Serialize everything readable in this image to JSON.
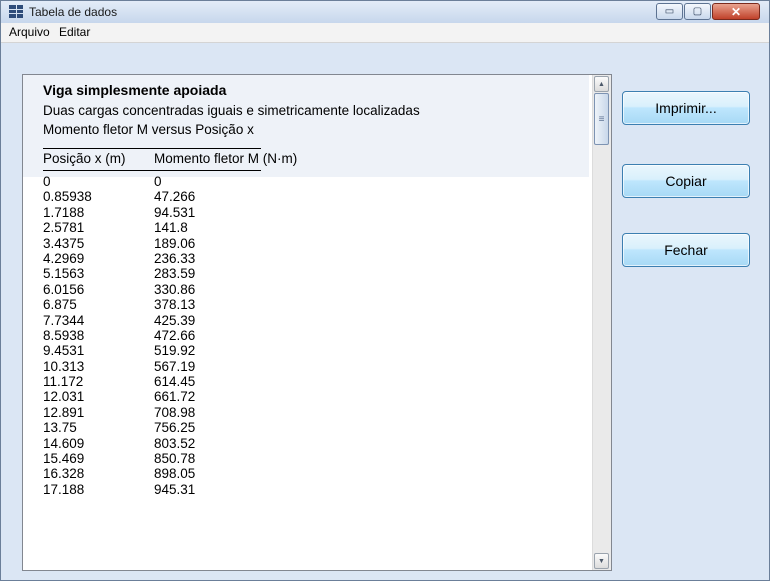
{
  "window": {
    "title": "Tabela de dados",
    "controls": {
      "minimize": "▭",
      "maximize": "▢",
      "close": "✕"
    }
  },
  "menu": [
    "Arquivo",
    "Editar"
  ],
  "content": {
    "heading": "Viga simplesmente apoiada",
    "subheading": "Duas cargas concentradas iguais e simetricamente localizadas",
    "caption": "Momento fletor M  versus Posição  x",
    "columns": [
      "Posição x (m)",
      "Momento fletor M (N·m)"
    ],
    "rows": [
      [
        "0",
        "0"
      ],
      [
        "0.85938",
        "47.266"
      ],
      [
        "1.7188",
        "94.531"
      ],
      [
        "2.5781",
        "141.8"
      ],
      [
        "3.4375",
        "189.06"
      ],
      [
        "4.2969",
        "236.33"
      ],
      [
        "5.1563",
        "283.59"
      ],
      [
        "6.0156",
        "330.86"
      ],
      [
        "6.875",
        "378.13"
      ],
      [
        "7.7344",
        "425.39"
      ],
      [
        "8.5938",
        "472.66"
      ],
      [
        "9.4531",
        "519.92"
      ],
      [
        "10.313",
        "567.19"
      ],
      [
        "11.172",
        "614.45"
      ],
      [
        "12.031",
        "661.72"
      ],
      [
        "12.891",
        "708.98"
      ],
      [
        "13.75",
        "756.25"
      ],
      [
        "14.609",
        "803.52"
      ],
      [
        "15.469",
        "850.78"
      ],
      [
        "16.328",
        "898.05"
      ],
      [
        "17.188",
        "945.31"
      ]
    ]
  },
  "buttons": {
    "print": "Imprimir...",
    "copy": "Copiar",
    "close": "Fechar"
  },
  "icons": {
    "app": "table-icon",
    "scroll_up": "▲",
    "scroll_down": "▼",
    "scroll_grip": "≡"
  }
}
